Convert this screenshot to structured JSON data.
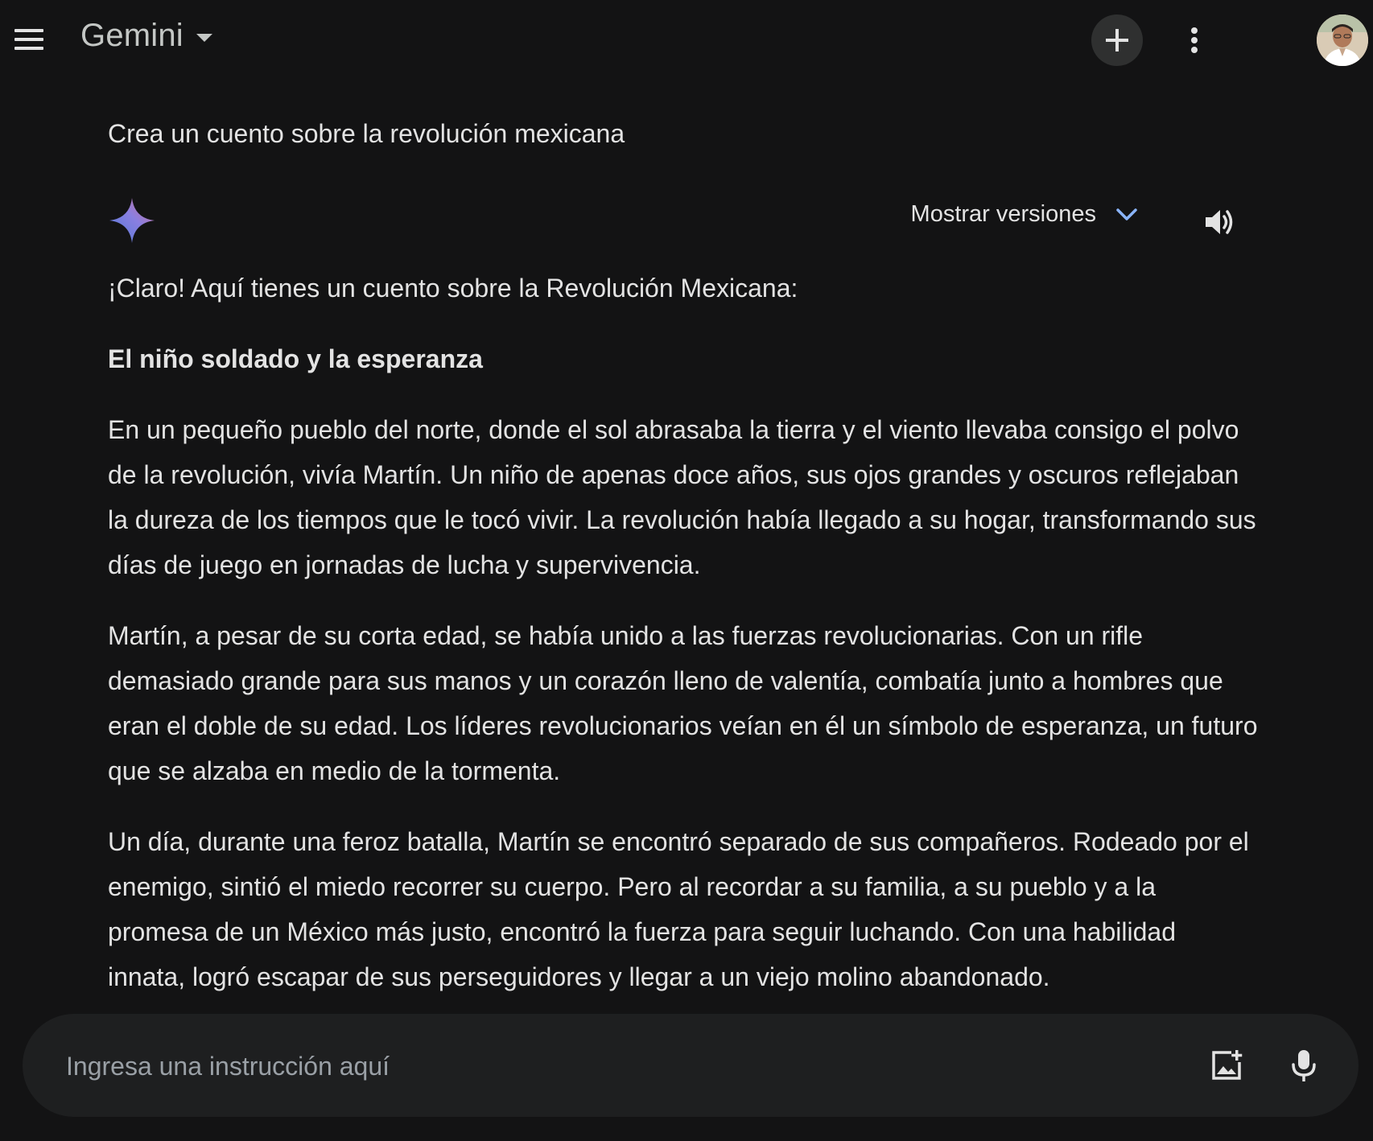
{
  "header": {
    "app_title": "Gemini",
    "menu_icon": "menu-icon",
    "new_chat_icon": "plus-icon",
    "more_icon": "more-vert-icon",
    "avatar_icon": "user-avatar"
  },
  "conversation": {
    "user_prompt": "Crea un cuento sobre la revolución mexicana",
    "response": {
      "show_versions_label": "Mostrar versiones",
      "intro": "¡Claro! Aquí tienes un cuento sobre la Revolución Mexicana:",
      "story_title": "El niño soldado y la esperanza",
      "paragraphs": [
        "En un pequeño pueblo del norte, donde el sol abrasaba la tierra y el viento llevaba consigo el polvo de la revolución, vivía Martín. Un niño de apenas doce años, sus ojos grandes y oscuros reflejaban la dureza de los tiempos que le tocó vivir. La revolución había llegado a su hogar, transformando sus días de juego en jornadas de lucha y supervivencia.",
        "Martín, a pesar de su corta edad, se había unido a las fuerzas revolucionarias. Con un rifle demasiado grande para sus manos y un corazón lleno de valentía, combatía junto a hombres que eran el doble de su edad. Los líderes revolucionarios veían en él un símbolo de esperanza, un futuro que se alzaba en medio de la tormenta.",
        "Un día, durante una feroz batalla, Martín se encontró separado de sus compañeros. Rodeado por el enemigo, sintió el miedo recorrer su cuerpo. Pero al recordar a su familia, a su pueblo y a la promesa de un México más justo, encontró la fuerza para seguir luchando. Con una habilidad innata, logró escapar de sus perseguidores y llegar a un viejo molino abandonado."
      ]
    }
  },
  "input": {
    "placeholder": "Ingresa una instrucción aquí",
    "value": ""
  },
  "colors": {
    "background": "#131314",
    "text": "#e3e3e3",
    "input_bg": "#1e1f20",
    "accent_blue": "#8ab4f8"
  }
}
